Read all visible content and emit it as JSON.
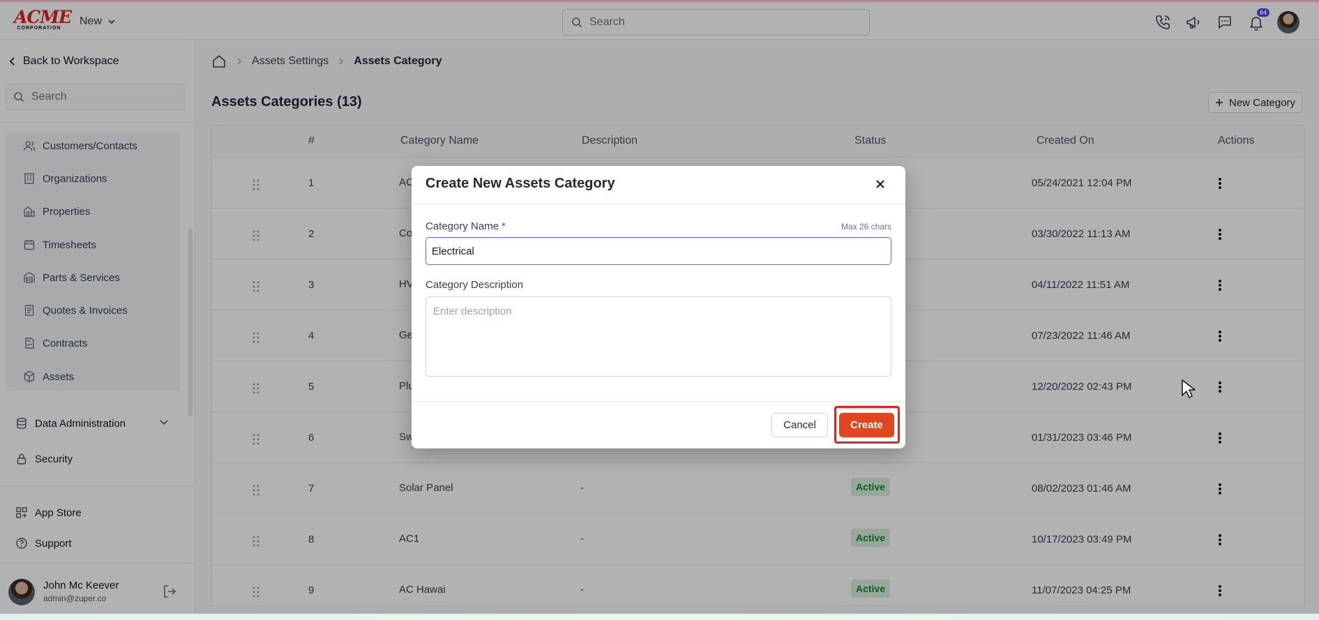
{
  "topbar": {
    "logo_main": "ACME",
    "logo_sub": "CORPORATION",
    "new_menu_label": "New",
    "search_placeholder": "Search",
    "notification_count": "64"
  },
  "sidebar": {
    "back_label": "Back to Workspace",
    "search_placeholder": "Search",
    "group_items": [
      {
        "label": "Customers/Contacts",
        "icon": "users-icon"
      },
      {
        "label": "Organizations",
        "icon": "building-icon"
      },
      {
        "label": "Properties",
        "icon": "property-icon"
      },
      {
        "label": "Timesheets",
        "icon": "calendar-icon"
      },
      {
        "label": "Parts & Services",
        "icon": "warehouse-icon"
      },
      {
        "label": "Quotes & Invoices",
        "icon": "invoice-icon"
      },
      {
        "label": "Contracts",
        "icon": "contract-icon"
      },
      {
        "label": "Assets",
        "icon": "cube-icon"
      }
    ],
    "main_items": [
      {
        "label": "Data Administration",
        "icon": "database-icon"
      },
      {
        "label": "Security",
        "icon": "lock-icon"
      },
      {
        "label": "App Store",
        "icon": "grid-plus-icon"
      },
      {
        "label": "Support",
        "icon": "help-circle-icon"
      }
    ],
    "user": {
      "name": "John Mc Keever",
      "email": "admin@zuper.co"
    }
  },
  "breadcrumb": {
    "items": [
      "Assets Settings",
      "Assets Category"
    ]
  },
  "page": {
    "title": "Assets Categories (13)",
    "new_button_label": "New Category"
  },
  "table": {
    "headers": [
      "#",
      "Category Name",
      "Description",
      "Status",
      "Created On",
      "Actions"
    ],
    "rows": [
      {
        "num": "1",
        "name": "AC",
        "desc": "",
        "status": "",
        "created": "05/24/2021 12:04 PM"
      },
      {
        "num": "2",
        "name": "Co",
        "desc": "",
        "status": "",
        "created": "03/30/2022 11:13 AM"
      },
      {
        "num": "3",
        "name": "HV",
        "desc": "",
        "status": "",
        "created": "04/11/2022 11:51 AM"
      },
      {
        "num": "4",
        "name": "Ge",
        "desc": "",
        "status": "",
        "created": "07/23/2022 11:46 AM"
      },
      {
        "num": "5",
        "name": "Plu",
        "desc": "",
        "status": "",
        "created": "12/20/2022 02:43 PM"
      },
      {
        "num": "6",
        "name": "Sw",
        "desc": "",
        "status": "",
        "created": "01/31/2023 03:46 PM"
      },
      {
        "num": "7",
        "name": "Solar Panel",
        "desc": "-",
        "status": "Active",
        "created": "08/02/2023 01:46 AM"
      },
      {
        "num": "8",
        "name": "AC1",
        "desc": "-",
        "status": "Active",
        "created": "10/17/2023 03:49 PM"
      },
      {
        "num": "9",
        "name": "AC Hawai",
        "desc": "-",
        "status": "Active",
        "created": "11/07/2023 04:25 PM"
      }
    ]
  },
  "modal": {
    "title": "Create New Assets Category",
    "name_label": "Category Name",
    "required_mark": "*",
    "max_hint": "Max 26 chars",
    "name_value": "Electrical",
    "desc_label": "Category Description",
    "desc_placeholder": "Enter description",
    "cancel_label": "Cancel",
    "create_label": "Create"
  },
  "colors": {
    "accent": "#e0461f",
    "active_badge": "#14833b",
    "brand": "#d9261c",
    "focus": "#6366f1"
  }
}
